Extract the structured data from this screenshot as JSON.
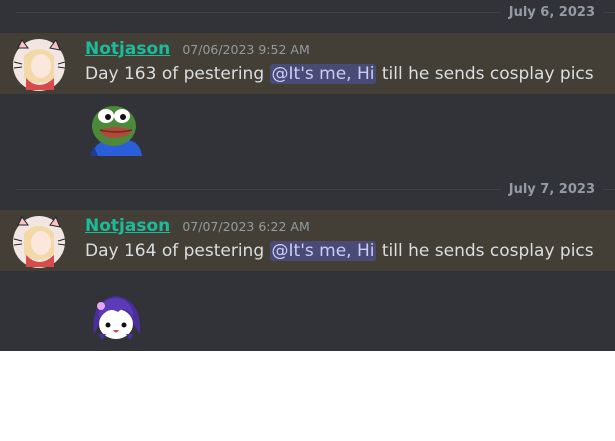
{
  "dividers": [
    {
      "date": "July 6, 2023"
    },
    {
      "date": "July 7, 2023"
    }
  ],
  "messages": [
    {
      "username": "Notjason",
      "timestamp": "07/06/2023 9:52 AM",
      "text_before": "Day 163 of pestering ",
      "mention": "@It's me, Hi",
      "text_after": " till he sends cosplay pics",
      "emoji_icon": "pepe-frog-emoji-icon"
    },
    {
      "username": "Notjason",
      "timestamp": "07/07/2023 6:22 AM",
      "text_before": "Day 164 of pestering ",
      "mention": "@It's me, Hi",
      "text_after": " till he sends cosplay pics",
      "emoji_icon": "anime-girl-emoji-icon"
    }
  ],
  "colors": {
    "background": "#313338",
    "highlight": "#433f36",
    "username": "#1abc9c",
    "mention_bg": "#4a4f8a",
    "text": "#dbdee1"
  }
}
